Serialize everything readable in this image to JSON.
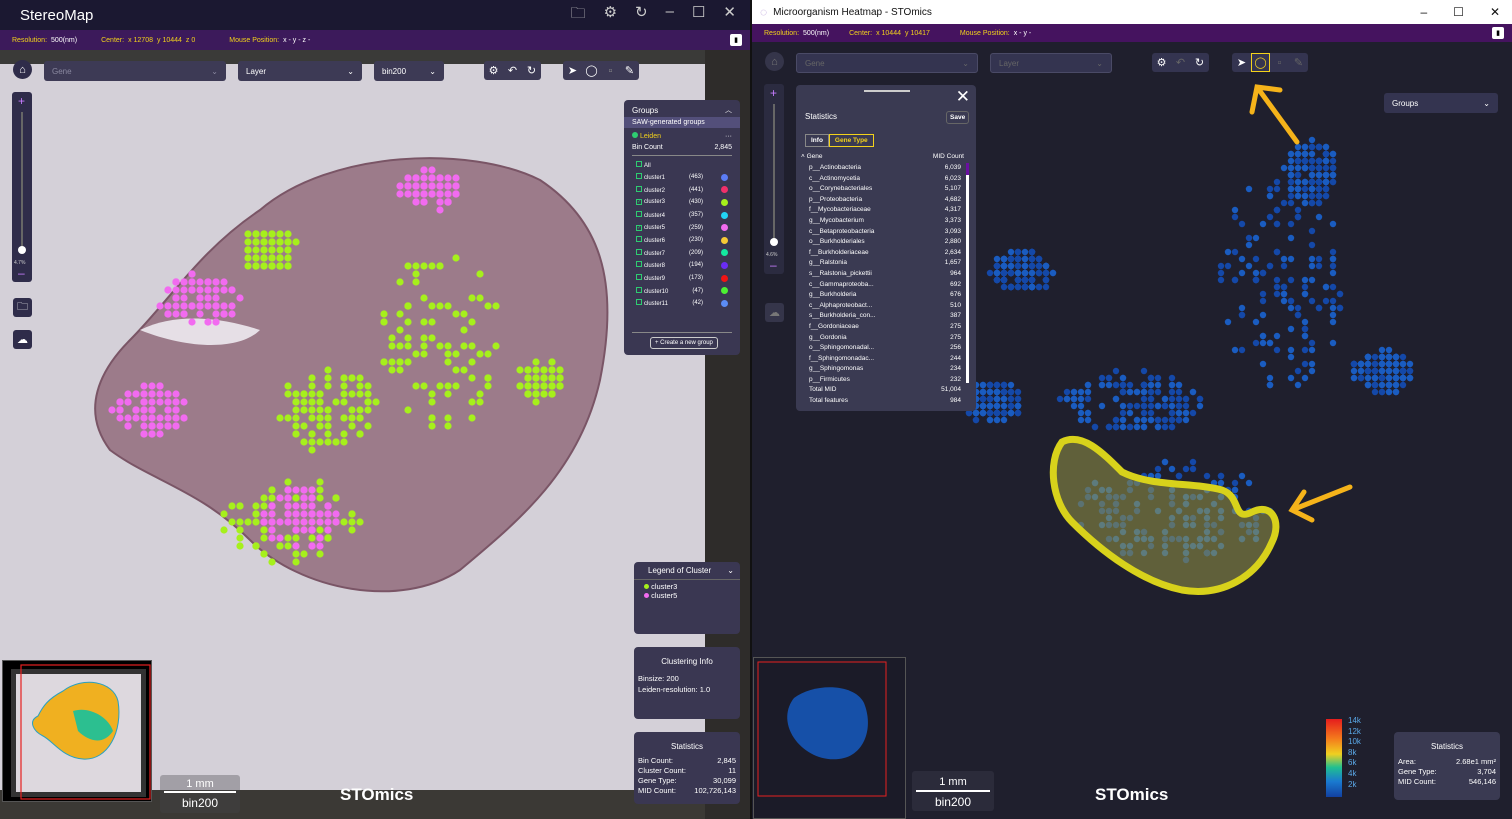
{
  "left": {
    "title": "StereoMap",
    "info": {
      "resolution_label": "Resolution:",
      "resolution": "500(nm)",
      "center_label": "Center:",
      "center_x": "x 12708",
      "center_y": "y 10444",
      "center_z": "z 0",
      "mouse_label": "Mouse Position:",
      "mouse": "x - y - z -"
    },
    "toolbar": {
      "gene_placeholder": "Gene",
      "layer": "Layer",
      "bin": "bin200"
    },
    "zoom_level": "4.7%",
    "groups": {
      "title": "Groups",
      "subtitle": "SAW-generated groups",
      "method": "Leiden",
      "bin_count_label": "Bin Count",
      "bin_count": "2,845",
      "all_label": "All",
      "clusters": [
        {
          "name": "cluster1",
          "count": "(463)",
          "color": "#5b7cf5",
          "checked": false
        },
        {
          "name": "cluster2",
          "count": "(441)",
          "color": "#f0306a",
          "checked": false
        },
        {
          "name": "cluster3",
          "count": "(430)",
          "color": "#a6f01c",
          "checked": true
        },
        {
          "name": "cluster4",
          "count": "(357)",
          "color": "#22d3f5",
          "checked": false
        },
        {
          "name": "cluster5",
          "count": "(259)",
          "color": "#f26bf0",
          "checked": true
        },
        {
          "name": "cluster6",
          "count": "(230)",
          "color": "#f5c935",
          "checked": false
        },
        {
          "name": "cluster7",
          "count": "(209)",
          "color": "#14e8a0",
          "checked": false
        },
        {
          "name": "cluster8",
          "count": "(194)",
          "color": "#6a2cf5",
          "checked": false
        },
        {
          "name": "cluster9",
          "count": "(173)",
          "color": "#f01414",
          "checked": false
        },
        {
          "name": "cluster10",
          "count": "(47)",
          "color": "#4cf032",
          "checked": false
        },
        {
          "name": "cluster11",
          "count": "(42)",
          "color": "#5b8cf5",
          "checked": false
        }
      ],
      "create_label": "+ Create a new group"
    },
    "legend": {
      "title": "Legend of Cluster",
      "items": [
        {
          "name": "cluster3",
          "color": "#a6f01c"
        },
        {
          "name": "cluster5",
          "color": "#f26bf0"
        }
      ]
    },
    "clustering": {
      "title": "Clustering Info",
      "binsize": "Binsize: 200",
      "resolution": "Leiden-resolution: 1.0"
    },
    "stats": {
      "title": "Statistics",
      "rows": [
        {
          "k": "Bin Count:",
          "v": "2,845"
        },
        {
          "k": "Cluster Count:",
          "v": "11"
        },
        {
          "k": "Gene Type:",
          "v": "30,099"
        },
        {
          "k": "MID Count:",
          "v": "102,726,143"
        }
      ]
    },
    "scale": {
      "length": "1 mm",
      "bin": "bin200"
    },
    "brand": "STOmics"
  },
  "right": {
    "title": "Microorganism Heatmap - STOmics",
    "info": {
      "resolution_label": "Resolution:",
      "resolution": "500(nm)",
      "center_label": "Center:",
      "center_x": "x 10444",
      "center_y": "y 10417",
      "mouse_label": "Mouse Position:",
      "mouse": "x - y -"
    },
    "toolbar": {
      "gene_placeholder": "Gene",
      "layer_placeholder": "Layer",
      "groups": "Groups"
    },
    "zoom_level": "4.6%",
    "statistics": {
      "title": "Statistics",
      "save": "Save",
      "tab_info": "Info",
      "tab_gene_type": "Gene Type",
      "col_gene": "Gene",
      "col_mid": "MID Count",
      "rows": [
        {
          "gene": "p__Actinobacteria",
          "mid": "6,039"
        },
        {
          "gene": "c__Actinomycetia",
          "mid": "6,023"
        },
        {
          "gene": "o__Corynebacteriales",
          "mid": "5,107"
        },
        {
          "gene": "p__Proteobacteria",
          "mid": "4,682"
        },
        {
          "gene": "f__Mycobacteriaceae",
          "mid": "4,317"
        },
        {
          "gene": "g__Mycobacterium",
          "mid": "3,373"
        },
        {
          "gene": "c__Betaproteobacteria",
          "mid": "3,093"
        },
        {
          "gene": "o__Burkholderiales",
          "mid": "2,880"
        },
        {
          "gene": "f__Burkholderiaceae",
          "mid": "2,634"
        },
        {
          "gene": "g__Ralstonia",
          "mid": "1,657"
        },
        {
          "gene": "s__Ralstonia_pickettii",
          "mid": "964"
        },
        {
          "gene": "c__Gammaproteoba...",
          "mid": "692"
        },
        {
          "gene": "g__Burkholderia",
          "mid": "676"
        },
        {
          "gene": "c__Alphaproteobact...",
          "mid": "510"
        },
        {
          "gene": "s__Burkholderia_con...",
          "mid": "387"
        },
        {
          "gene": "f__Gordoniaceae",
          "mid": "275"
        },
        {
          "gene": "g__Gordonia",
          "mid": "275"
        },
        {
          "gene": "o__Sphingomonadal...",
          "mid": "256"
        },
        {
          "gene": "f__Sphingomonadac...",
          "mid": "244"
        },
        {
          "gene": "g__Sphingomonas",
          "mid": "234"
        },
        {
          "gene": "p__Firmicutes",
          "mid": "232"
        }
      ],
      "total_mid_label": "Total MID",
      "total_mid": "51,004",
      "total_features_label": "Total features",
      "total_features": "984"
    },
    "colorbar": {
      "ticks": [
        "14k",
        "12k",
        "10k",
        "8k",
        "6k",
        "4k",
        "2k"
      ]
    },
    "stats": {
      "title": "Statistics",
      "rows": [
        {
          "k": "Area:",
          "v": "2.68e1 mm²"
        },
        {
          "k": "Gene Type:",
          "v": "3,704"
        },
        {
          "k": "MID Count:",
          "v": "546,146"
        }
      ]
    },
    "scale": {
      "length": "1 mm",
      "bin": "bin200"
    },
    "brand": "STOmics",
    "accent": "#f3d21b",
    "annotation_arrow_color": "#f5b31a"
  }
}
